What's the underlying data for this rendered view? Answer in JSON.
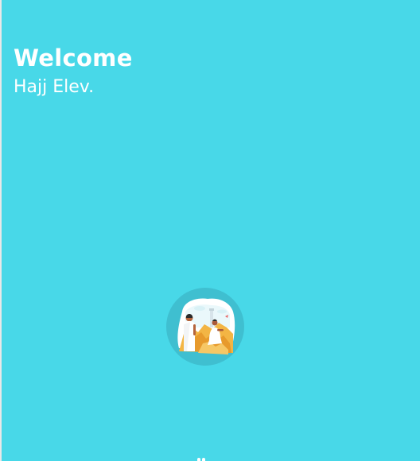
{
  "welcome": {
    "title": "Welcome",
    "subtitle": "Hajj Elev."
  },
  "logo": {
    "name": "pilgrims-illustration-logo"
  },
  "colors": {
    "background": "#48d8e8",
    "logo_circle": "#3fbfd0",
    "text": "#ffffff"
  }
}
